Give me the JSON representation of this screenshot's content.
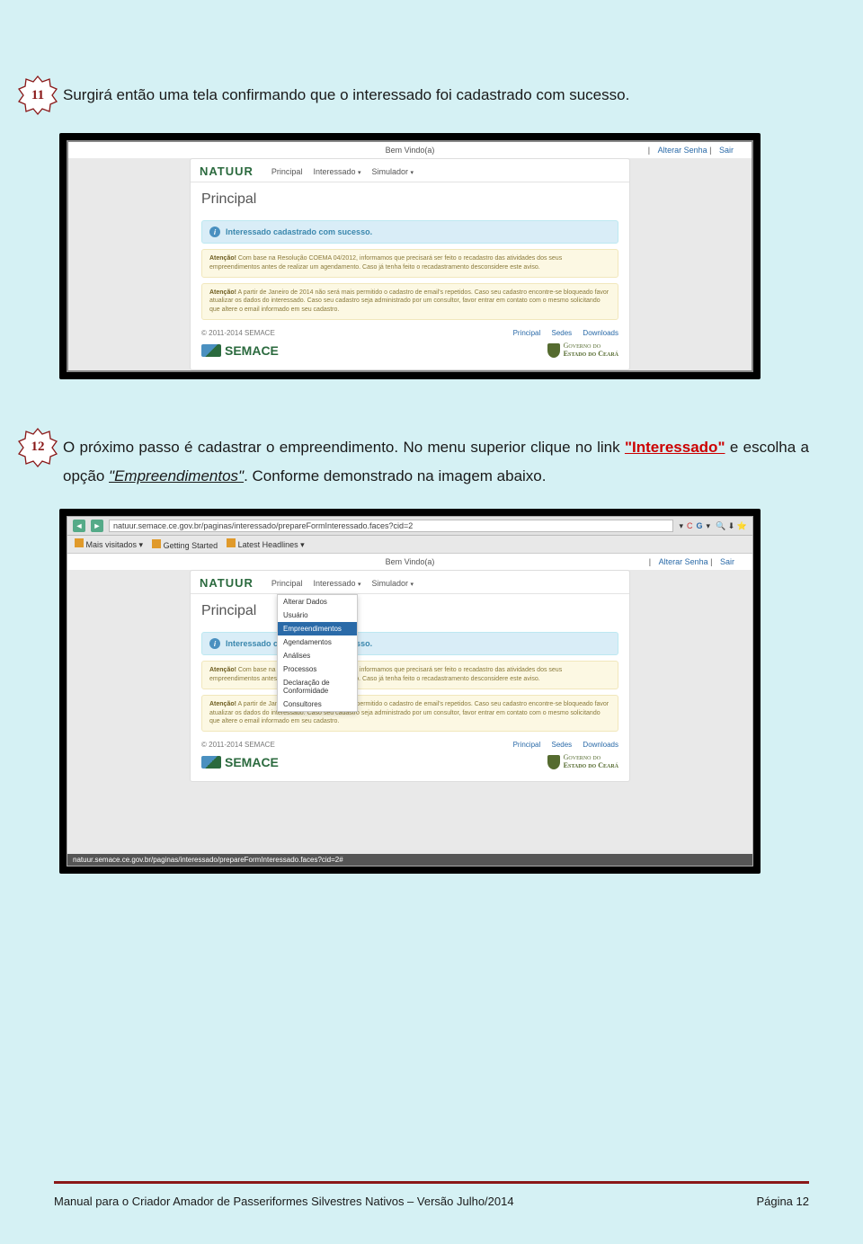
{
  "steps": {
    "s11": {
      "num": "11",
      "text": "Surgirá então uma tela confirmando que o interessado foi cadastrado com sucesso."
    },
    "s12": {
      "num": "12",
      "pre": "O próximo passo é cadastrar o empreendimento. No menu superior clique no link ",
      "link1": "\"Interessado\"",
      "mid": " e escolha a opção ",
      "link2": "\"Empreendimentos\"",
      "post": ". Conforme demonstrado na imagem abaixo."
    }
  },
  "app1": {
    "welcome": "Bem Vindo(a)",
    "links": {
      "alterar": "Alterar Senha",
      "sair": "Sair"
    },
    "brand": "NATUUR",
    "nav": {
      "principal": "Principal",
      "interessado": "Interessado",
      "simulador": "Simulador"
    },
    "title": "Principal",
    "success": "Interessado cadastrado com sucesso.",
    "warn1_b": "Atenção!",
    "warn1": " Com base na Resolução COEMA 04/2012, informamos que precisará ser feito o recadastro das atividades dos seus empreendimentos antes de realizar um agendamento. Caso já tenha feito o recadastramento desconsidere este aviso.",
    "warn2_b": "Atenção!",
    "warn2": " A partir de Janeiro de 2014 não será mais permitido o cadastro de email's repetidos. Caso seu cadastro encontre-se bloqueado favor atualizar os dados do interessado. Caso seu cadastro seja administrado por um consultor, favor entrar em contato com o mesmo solicitando que altere o email informado em seu cadastro.",
    "copyright": "© 2011-2014 SEMACE",
    "footer_links": {
      "principal": "Principal",
      "sedes": "Sedes",
      "downloads": "Downloads"
    },
    "semace": "SEMACE",
    "gov1": "Governo do",
    "gov2": "Estado do Ceará"
  },
  "app2": {
    "url": "natuur.semace.ce.gov.br/paginas/interessado/prepareFormInteressado.faces?cid=2",
    "bookmarks": {
      "mais": "Mais visitados ▾",
      "gs": "Getting Started",
      "lh": "Latest Headlines ▾"
    },
    "welcome": "Bem Vindo(a)",
    "links": {
      "alterar": "Alterar Senha",
      "sair": "Sair"
    },
    "brand": "NATUUR",
    "nav": {
      "principal": "Principal",
      "interessado": "Interessado",
      "simulador": "Simulador"
    },
    "title": "Principal",
    "dropdown": [
      "Alterar Dados",
      "Usuário",
      "Empreendimentos",
      "Agendamentos",
      "Análises",
      "Processos",
      "Declaração de Conformidade",
      "Consultores"
    ],
    "success": "Interessado cadastrado com sucesso.",
    "warn1_b": "Atenção!",
    "warn1": " Com base na Resolução COEMA 04/2012, informamos que precisará ser feito o recadastro das atividades dos seus empreendimentos antes de realizar um agendamento. Caso já tenha feito o recadastramento desconsidere este aviso.",
    "warn2_b": "Atenção!",
    "warn2": " A partir de Janeiro de 2014 não será mais permitido o cadastro de email's repetidos. Caso seu cadastro encontre-se bloqueado favor atualizar os dados do interessado. Caso seu cadastro seja administrado por um consultor, favor entrar em contato com o mesmo solicitando que altere o email informado em seu cadastro.",
    "copyright": "© 2011-2014 SEMACE",
    "footer_links": {
      "principal": "Principal",
      "sedes": "Sedes",
      "downloads": "Downloads"
    },
    "semace": "SEMACE",
    "gov1": "Governo do",
    "gov2": "Estado do Ceará",
    "status": "natuur.semace.ce.gov.br/paginas/interessado/prepareFormInteressado.faces?cid=2#"
  },
  "footer": {
    "left": "Manual para o Criador Amador de Passeriformes Silvestres Nativos – Versão Julho/2014",
    "right": "Página 12"
  }
}
